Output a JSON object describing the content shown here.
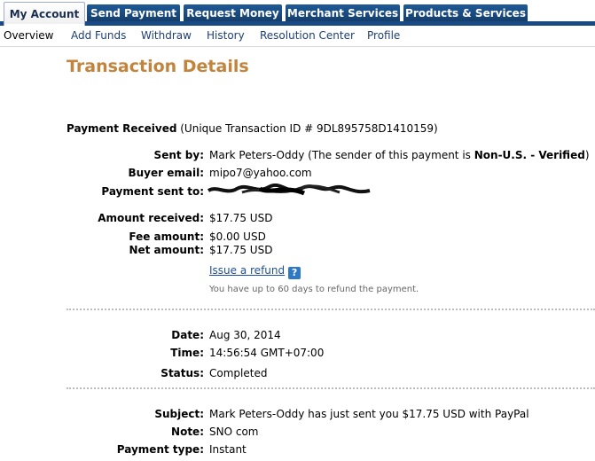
{
  "tabs": [
    {
      "label": "My Account",
      "active": true
    },
    {
      "label": "Send Payment"
    },
    {
      "label": "Request Money"
    },
    {
      "label": "Merchant Services"
    },
    {
      "label": "Products & Services"
    }
  ],
  "subnav": [
    "Overview",
    "Add Funds",
    "Withdraw",
    "History",
    "Resolution Center",
    "Profile"
  ],
  "page_title": "Transaction Details",
  "summary": {
    "title": "Payment Received",
    "transaction_id_text": "(Unique Transaction ID # 9DL895758D1410159)"
  },
  "sender": {
    "label": "Sent by:",
    "name": "Mark Peters-Oddy",
    "note_prefix": "(The sender of this payment is ",
    "status": "Non-U.S. - Verified",
    "note_suffix": ")"
  },
  "buyer_email": {
    "label": "Buyer email:",
    "value": "mipo7@yahoo.com"
  },
  "payment_sent_to": {
    "label": "Payment sent to:"
  },
  "amounts": {
    "received_label": "Amount received:",
    "received": "$17.75 USD",
    "fee_label": "Fee amount:",
    "fee": "$0.00 USD",
    "net_label": "Net amount:",
    "net": "$17.75 USD"
  },
  "refund": {
    "link": "Issue a refund",
    "help_icon": "?",
    "note": "You have up to 60 days to refund the payment."
  },
  "details": {
    "date_label": "Date:",
    "date": "Aug 30, 2014",
    "time_label": "Time:",
    "time": "14:56:54 GMT+07:00",
    "status_label": "Status:",
    "status": "Completed"
  },
  "message": {
    "subject_label": "Subject:",
    "subject": "Mark Peters-Oddy has just sent you $17.75 USD with PayPal",
    "note_label": "Note:",
    "note": "SNO com",
    "type_label": "Payment type:",
    "type": "Instant"
  },
  "colors": {
    "tab_blue": "#1a4a84",
    "heading": "#c2843d",
    "link": "#1f4f97"
  }
}
